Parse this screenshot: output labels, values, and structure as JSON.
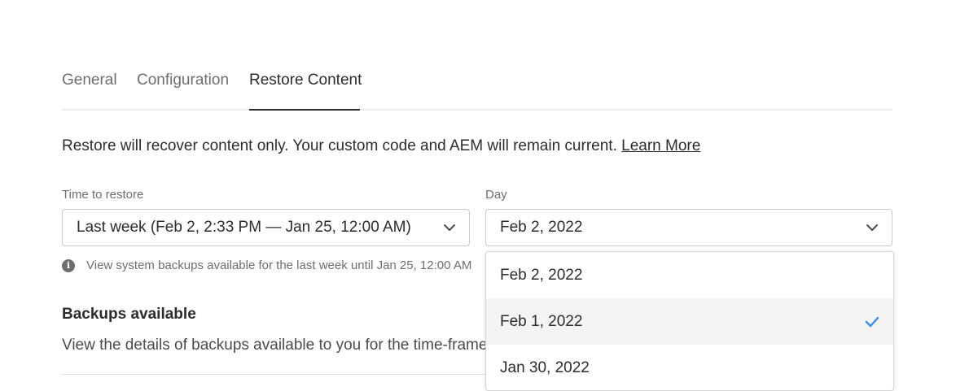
{
  "tabs": [
    {
      "label": "General",
      "active": false
    },
    {
      "label": "Configuration",
      "active": false
    },
    {
      "label": "Restore Content",
      "active": true
    }
  ],
  "description": {
    "text": "Restore will recover content only. Your custom code and AEM will remain current. ",
    "link": "Learn More"
  },
  "time_field": {
    "label": "Time to restore",
    "value": "Last week  (Feb 2, 2:33 PM — Jan 25, 12:00 AM)",
    "icon": "chevron-down-icon"
  },
  "day_field": {
    "label": "Day",
    "value": "Feb 2, 2022",
    "icon": "chevron-down-icon"
  },
  "help": {
    "icon": "info-icon",
    "text": "View system backups available for the last week until Jan 25, 12:00 AM"
  },
  "backups": {
    "heading": "Backups available",
    "text": "View the details of backups available to you for the time-frame selected."
  },
  "day_menu": {
    "items": [
      {
        "label": "Feb 2, 2022",
        "selected": false
      },
      {
        "label": "Feb 1, 2022",
        "selected": true
      },
      {
        "label": "Jan 30, 2022",
        "selected": false
      }
    ]
  },
  "colors": {
    "accent": "#378ef0",
    "text": "#2c2c2c",
    "muted": "#6e6e6e"
  }
}
